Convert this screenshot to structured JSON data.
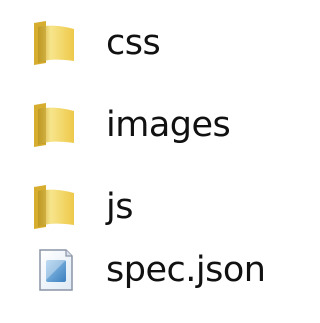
{
  "items": [
    {
      "label": "css",
      "icon": "folder-icon",
      "type": "folder"
    },
    {
      "label": "images",
      "icon": "folder-icon",
      "type": "folder"
    },
    {
      "label": "js",
      "icon": "folder-icon",
      "type": "folder"
    },
    {
      "label": "spec.json",
      "icon": "file-icon",
      "type": "file"
    }
  ],
  "colors": {
    "folder_light": "#f7e58c",
    "folder_mid": "#eec94a",
    "folder_dark": "#c9a227",
    "file_border": "#8a94a6",
    "file_fill": "#eaf3fb",
    "file_accent": "#4a90c8",
    "text": "#111111"
  }
}
